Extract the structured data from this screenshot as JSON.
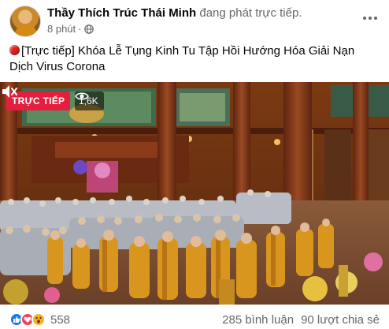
{
  "post": {
    "author": "Thầy Thích Trúc Thái Minh",
    "action": "đang phát trực tiếp.",
    "time": "8 phút",
    "separator": "·",
    "privacy_icon": "globe-icon",
    "text": "[Trực tiếp] Khóa Lễ Tụng Kinh Tu Tập Hồi Hướng Hóa Giải Nạn Dịch Virus Corona"
  },
  "video": {
    "live_label": "TRỰC TIẾP",
    "viewer_count": "1,6K",
    "viewer_icon": "eye-icon",
    "sound_icon": "speaker-icon"
  },
  "footer": {
    "reaction_icons": [
      "like-icon",
      "love-icon",
      "wow-icon"
    ],
    "reaction_count": "558",
    "comments": "285 bình luận",
    "shares": "90 lượt chia sẻ"
  },
  "colors": {
    "live_red": "#e41e3f",
    "like_blue": "#1877f2",
    "love_red": "#f33e58",
    "wow_yellow": "#f7b125",
    "robe_saffron": "#d9961f"
  }
}
